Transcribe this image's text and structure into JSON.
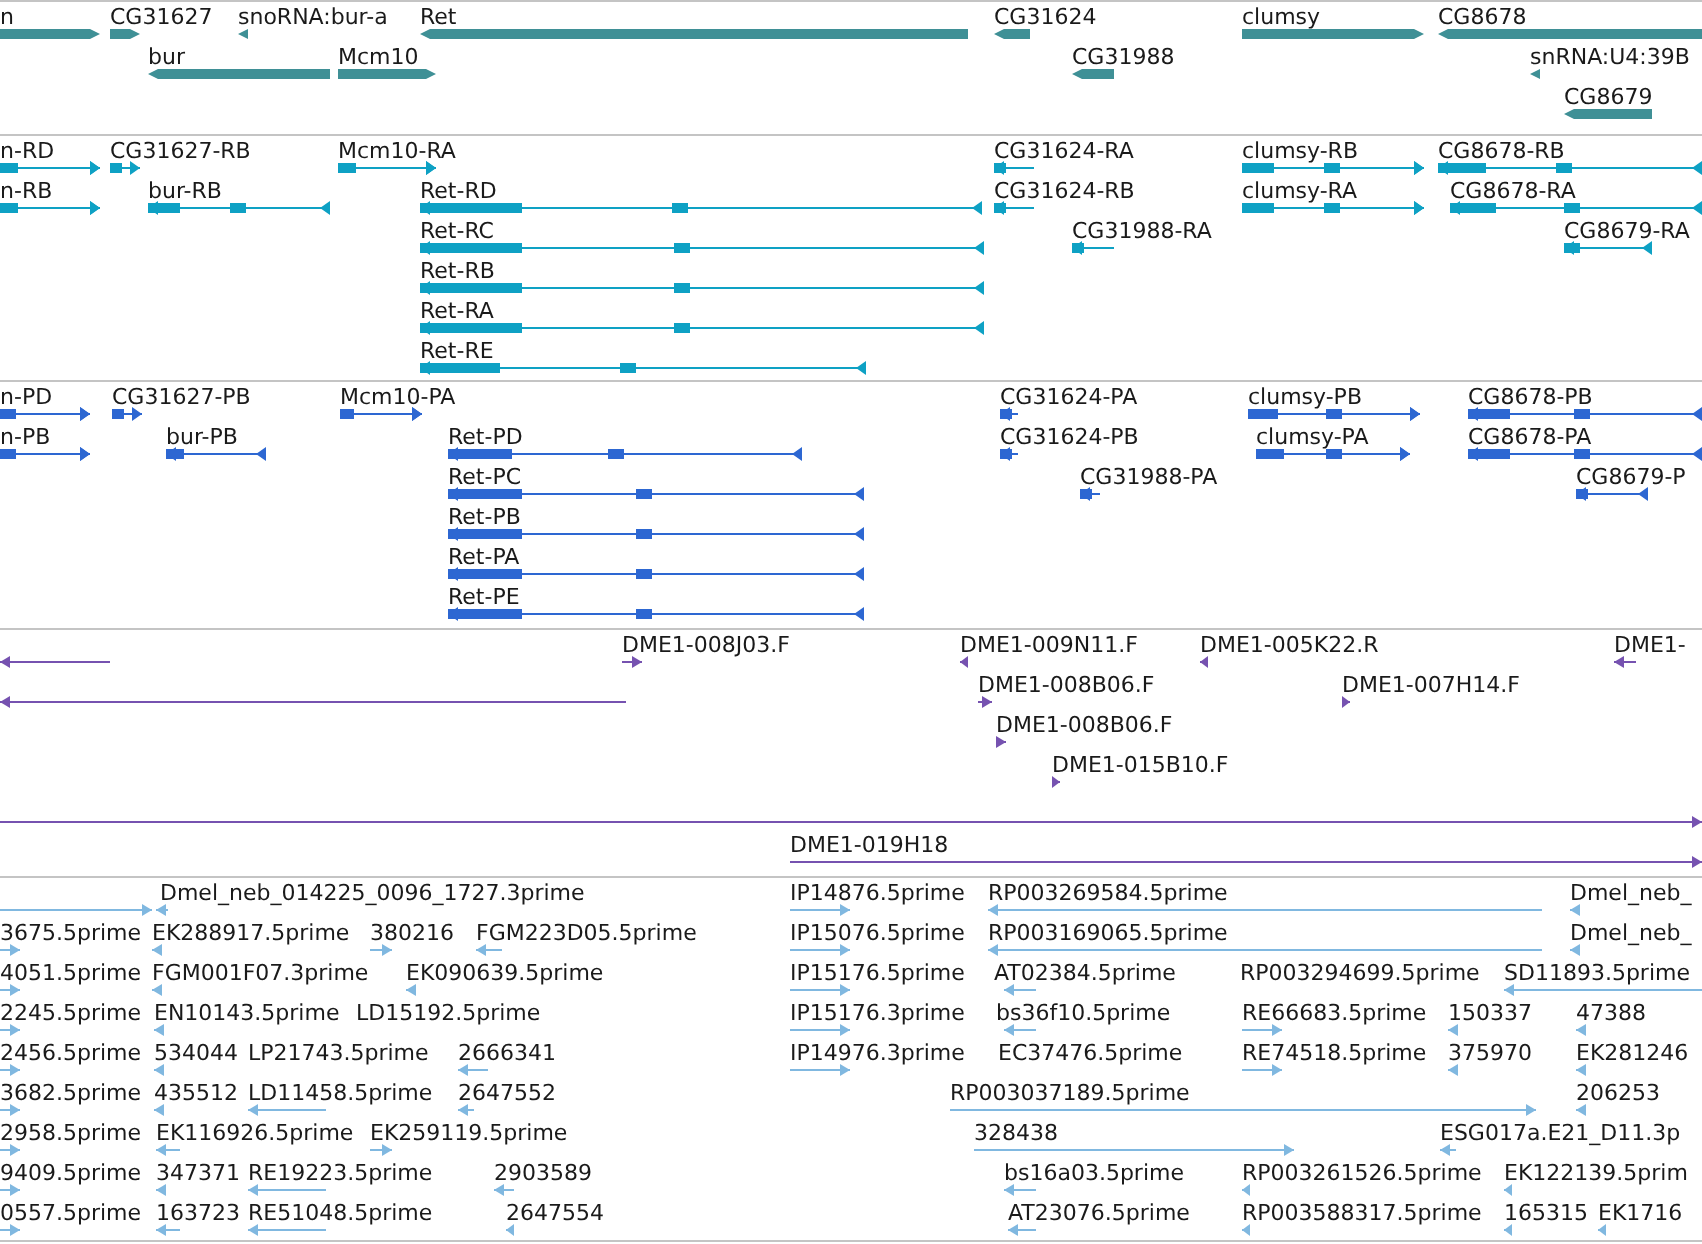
{
  "tracks": [
    {
      "kind": "gene",
      "features": [
        {
          "label": "n",
          "reverse": false
        },
        {
          "label": "CG31627",
          "reverse": false
        },
        {
          "label": "snoRNA:bur-a",
          "reverse": true
        },
        {
          "label": "Ret",
          "reverse": true
        },
        {
          "label": "CG31624",
          "reverse": true
        },
        {
          "label": "clumsy",
          "reverse": false
        },
        {
          "label": "CG8678",
          "reverse": true
        },
        {
          "label": "bur",
          "reverse": true
        },
        {
          "label": "Mcm10",
          "reverse": false
        },
        {
          "label": "CG31988",
          "reverse": true
        },
        {
          "label": "snRNA:U4:39B",
          "reverse": true
        },
        {
          "label": "CG8679",
          "reverse": true
        }
      ]
    },
    {
      "kind": "transcript",
      "features": [
        {
          "label": "n-RD",
          "reverse": false
        },
        {
          "label": "CG31627-RB",
          "reverse": false
        },
        {
          "label": "Mcm10-RA",
          "reverse": false
        },
        {
          "label": "CG31624-RA",
          "reverse": true
        },
        {
          "label": "clumsy-RB",
          "reverse": false
        },
        {
          "label": "CG8678-RB",
          "reverse": true
        },
        {
          "label": "n-RB",
          "reverse": false
        },
        {
          "label": "bur-RB",
          "reverse": true
        },
        {
          "label": "Ret-RD",
          "reverse": true
        },
        {
          "label": "CG31624-RB",
          "reverse": true
        },
        {
          "label": "clumsy-RA",
          "reverse": false
        },
        {
          "label": "CG8678-RA",
          "reverse": true
        },
        {
          "label": "Ret-RC",
          "reverse": true
        },
        {
          "label": "CG31988-RA",
          "reverse": true
        },
        {
          "label": "CG8679-RA",
          "reverse": true
        },
        {
          "label": "Ret-RB",
          "reverse": true
        },
        {
          "label": "Ret-RA",
          "reverse": true
        },
        {
          "label": "Ret-RE",
          "reverse": true
        }
      ]
    },
    {
      "kind": "protein",
      "features": [
        {
          "label": "n-PD",
          "reverse": false
        },
        {
          "label": "CG31627-PB",
          "reverse": false
        },
        {
          "label": "Mcm10-PA",
          "reverse": false
        },
        {
          "label": "CG31624-PA",
          "reverse": true
        },
        {
          "label": "clumsy-PB",
          "reverse": false
        },
        {
          "label": "CG8678-PB",
          "reverse": true
        },
        {
          "label": "n-PB",
          "reverse": false
        },
        {
          "label": "bur-PB",
          "reverse": true
        },
        {
          "label": "Ret-PD",
          "reverse": true
        },
        {
          "label": "CG31624-PB",
          "reverse": true
        },
        {
          "label": "clumsy-PA",
          "reverse": false
        },
        {
          "label": "CG8678-PA",
          "reverse": true
        },
        {
          "label": "Ret-PC",
          "reverse": true
        },
        {
          "label": "CG31988-PA",
          "reverse": true
        },
        {
          "label": "CG8679-P",
          "reverse": true
        },
        {
          "label": "Ret-PB",
          "reverse": true
        },
        {
          "label": "Ret-PA",
          "reverse": true
        },
        {
          "label": "Ret-PE",
          "reverse": true
        }
      ]
    },
    {
      "kind": "clone",
      "features": [
        {
          "reverse": true
        },
        {
          "label": "DME1-008J03.F",
          "reverse": false
        },
        {
          "label": "DME1-009N11.F",
          "reverse": true
        },
        {
          "label": "DME1-005K22.R",
          "reverse": true
        },
        {
          "label": "DME1-",
          "reverse": true
        },
        {
          "reverse": true
        },
        {
          "label": "DME1-008B06.F",
          "reverse": false
        },
        {
          "label": "DME1-007H14.F",
          "reverse": false
        },
        {
          "label": "DME1-008B06.F",
          "reverse": false
        },
        {
          "label": "DME1-015B10.F",
          "reverse": false
        },
        {
          "reverse": false
        },
        {
          "label": "DME1-019H18",
          "reverse": false
        }
      ]
    },
    {
      "kind": "est",
      "features": [
        {
          "reverse": false
        },
        {
          "label": "Dmel_neb_014225_0096_1727.3prime",
          "reverse": true
        },
        {
          "label": "IP14876.5prime",
          "reverse": false
        },
        {
          "label": "RP003269584.5prime",
          "reverse": true
        },
        {
          "label": "Dmel_neb_",
          "reverse": true
        },
        {
          "label": "3675.5prime",
          "reverse": false
        },
        {
          "label": "EK288917.5prime",
          "reverse": true
        },
        {
          "label": "380216",
          "reverse": false
        },
        {
          "label": "FGM223D05.5prime",
          "reverse": true
        },
        {
          "label": "IP15076.5prime",
          "reverse": false
        },
        {
          "label": "RP003169065.5prime",
          "reverse": true
        },
        {
          "label": "Dmel_neb_",
          "reverse": true
        },
        {
          "label": "4051.5prime",
          "reverse": false
        },
        {
          "label": "FGM001F07.3prime",
          "reverse": true
        },
        {
          "label": "EK090639.5prime",
          "reverse": true
        },
        {
          "label": "IP15176.5prime",
          "reverse": false
        },
        {
          "label": "AT02384.5prime",
          "reverse": true
        },
        {
          "label": "RP003294699.5prime"
        },
        {
          "label": "SD11893.5prime",
          "reverse": true
        },
        {
          "label": "2245.5prime",
          "reverse": false
        },
        {
          "label": "EN10143.5prime",
          "reverse": true
        },
        {
          "label": "LD15192.5prime"
        },
        {
          "label": "IP15176.3prime",
          "reverse": false
        },
        {
          "label": "bs36f10.5prime",
          "reverse": true
        },
        {
          "label": "RE66683.5prime",
          "reverse": false
        },
        {
          "label": "150337",
          "reverse": true
        },
        {
          "label": "47388",
          "reverse": true
        },
        {
          "label": "2456.5prime",
          "reverse": false
        },
        {
          "label": "534044",
          "reverse": true
        },
        {
          "label": "LP21743.5prime"
        },
        {
          "label": "2666341",
          "reverse": true
        },
        {
          "label": "IP14976.3prime",
          "reverse": false
        },
        {
          "label": "EC37476.5prime"
        },
        {
          "label": "RE74518.5prime",
          "reverse": false
        },
        {
          "label": "375970",
          "reverse": true
        },
        {
          "label": "EK281246",
          "reverse": true
        },
        {
          "label": "3682.5prime",
          "reverse": false
        },
        {
          "label": "435512",
          "reverse": true
        },
        {
          "label": "LD11458.5prime",
          "reverse": true
        },
        {
          "label": "2647552",
          "reverse": true
        },
        {
          "label": "RP003037189.5prime",
          "reverse": false
        },
        {
          "label": "206253",
          "reverse": true
        },
        {
          "label": "2958.5prime",
          "reverse": false
        },
        {
          "label": "EK116926.5prime",
          "reverse": true
        },
        {
          "label": "EK259119.5prime",
          "reverse": false
        },
        {
          "label": "328438",
          "reverse": false
        },
        {
          "label": "ESG017a.E21_D11.3p",
          "reverse": true
        },
        {
          "label": "9409.5prime",
          "reverse": false
        },
        {
          "label": "347371",
          "reverse": true
        },
        {
          "label": "RE19223.5prime",
          "reverse": true
        },
        {
          "label": "2903589",
          "reverse": true
        },
        {
          "label": "bs16a03.5prime",
          "reverse": true
        },
        {
          "label": "RP003261526.5prime",
          "reverse": true
        },
        {
          "label": "EK122139.5prim",
          "reverse": true
        },
        {
          "label": "0557.5prime",
          "reverse": false
        },
        {
          "label": "163723",
          "reverse": true
        },
        {
          "label": "RE51048.5prime",
          "reverse": true
        },
        {
          "label": "2647554",
          "reverse": true
        },
        {
          "label": "AT23076.5prime",
          "reverse": true
        },
        {
          "label": "RP003588317.5prime",
          "reverse": true
        },
        {
          "label": "165315",
          "reverse": true
        },
        {
          "label": "EK1716",
          "reverse": true
        }
      ]
    }
  ]
}
